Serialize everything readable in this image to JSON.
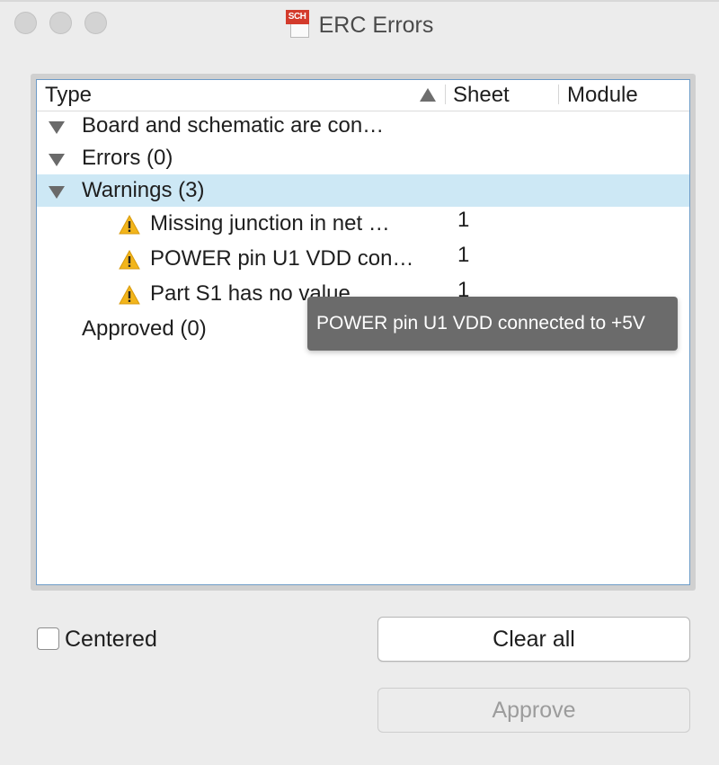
{
  "window": {
    "title": "ERC Errors",
    "icon_text": "SCH"
  },
  "tree": {
    "columns": {
      "type": "Type",
      "sheet": "Sheet",
      "module": "Module"
    },
    "sort_indicator": "ascending",
    "groups": {
      "board": "Board and schematic are con…",
      "errors": "Errors (0)",
      "warnings": "Warnings (3)",
      "approved": "Approved (0)"
    },
    "warnings": [
      {
        "label": "Missing junction in net …",
        "sheet": "1"
      },
      {
        "label": "POWER pin U1 VDD con…",
        "sheet": "1"
      },
      {
        "label": "Part S1 has no value",
        "sheet": "1"
      }
    ]
  },
  "tooltip": {
    "text": "POWER pin U1 VDD connected to +5V"
  },
  "controls": {
    "centered_label": "Centered",
    "centered_checked": false,
    "clear_all_label": "Clear all",
    "approve_label": "Approve"
  },
  "colors": {
    "selection": "#cde8f5",
    "warning_icon": "#f2b51b",
    "tooltip_bg": "#6b6b6b",
    "icon_red": "#d33b2c"
  }
}
